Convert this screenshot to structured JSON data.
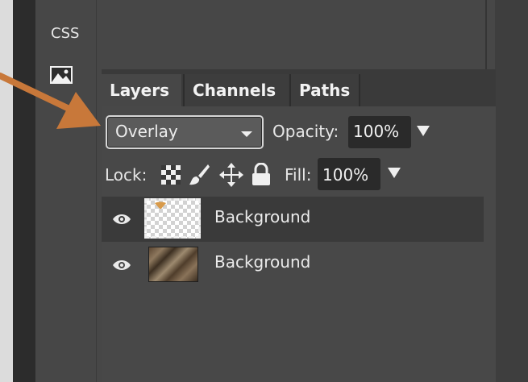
{
  "sidebar": {
    "css_label": "CSS",
    "image_icon": "image-icon"
  },
  "tabs": [
    {
      "label": "Layers",
      "active": true
    },
    {
      "label": "Channels",
      "active": false
    },
    {
      "label": "Paths",
      "active": false
    }
  ],
  "blend": {
    "selected": "Overlay",
    "opacity_label": "Opacity:",
    "opacity_value": "100%"
  },
  "lock": {
    "label": "Lock:",
    "icons": [
      "lock-transparency-icon",
      "lock-pixels-brush-icon",
      "lock-position-move-icon",
      "lock-all-padlock-icon"
    ],
    "fill_label": "Fill:",
    "fill_value": "100%"
  },
  "layers": [
    {
      "name": "Background",
      "visible": true,
      "selected": true,
      "thumbnail": "transparent-checker"
    },
    {
      "name": "Background",
      "visible": true,
      "selected": false,
      "thumbnail": "wood-texture"
    }
  ],
  "colors": {
    "panel": "#474747",
    "tabbar": "#3a3a3a",
    "annotation_arrow": "#c8783a"
  }
}
